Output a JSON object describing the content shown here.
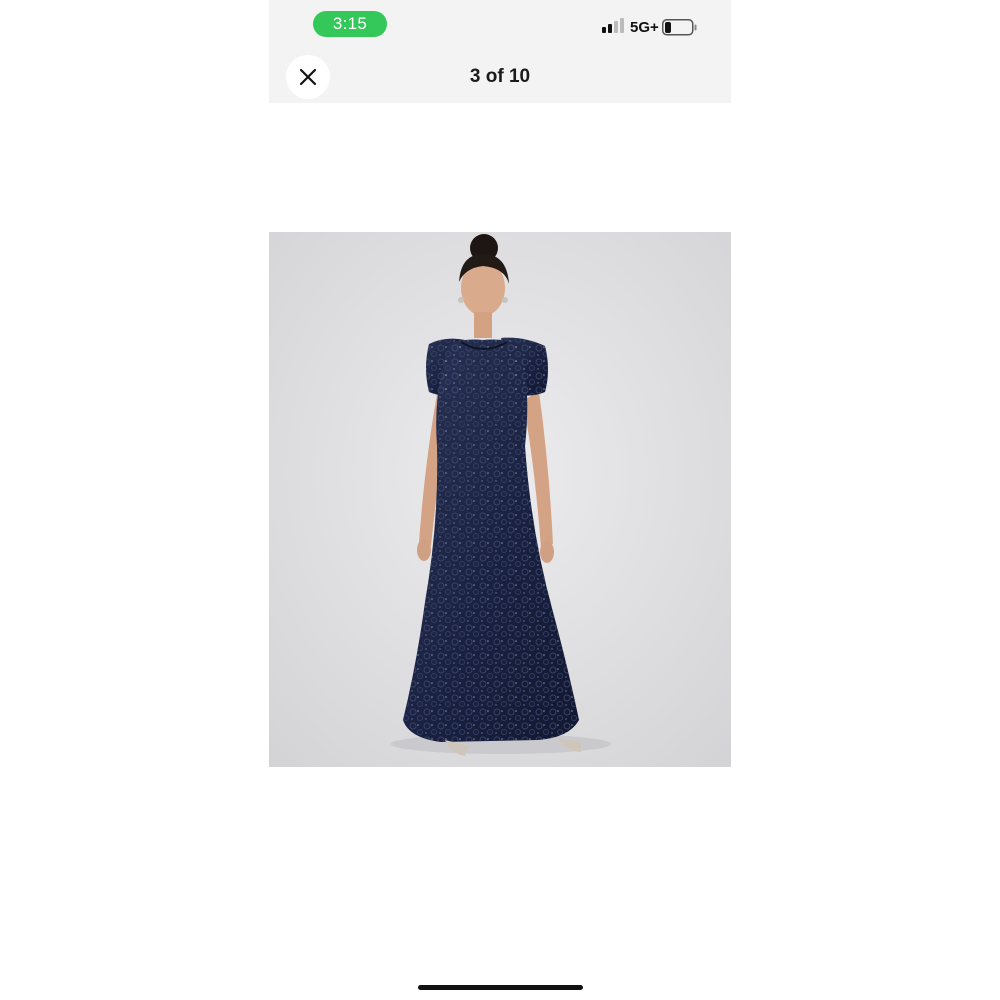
{
  "status_bar": {
    "time": "3:15",
    "network": "5G+",
    "icons": [
      "signal-bars-icon",
      "battery-icon"
    ],
    "colors": {
      "time_pill": "#34c759"
    }
  },
  "viewer": {
    "counter": "3 of 10",
    "close_icon": "close-icon"
  },
  "image": {
    "subject": "Model wearing a floor-length navy blue sequined lace gown with short sleeves",
    "colors": {
      "dress": "#1c2440",
      "background": "#e2e2e4"
    }
  }
}
